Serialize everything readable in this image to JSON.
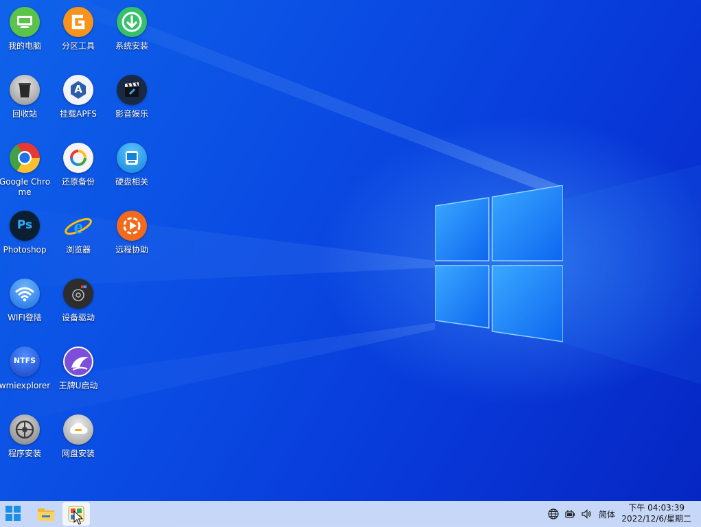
{
  "desktop": {
    "icons": [
      {
        "label": "我的电脑",
        "icon": "monitor-icon"
      },
      {
        "label": "分区工具",
        "icon": "partition-tool-icon"
      },
      {
        "label": "系统安装",
        "icon": "download-install-icon"
      },
      {
        "label": "回收站",
        "icon": "recycle-bin-icon"
      },
      {
        "label": "挂载APFS",
        "icon": "apfs-icon"
      },
      {
        "label": "影音娱乐",
        "icon": "clapper-icon"
      },
      {
        "label": "Google Chrome",
        "icon": "chrome-icon"
      },
      {
        "label": "还原备份",
        "icon": "restore-icon"
      },
      {
        "label": "硬盘相关",
        "icon": "disk-icon"
      },
      {
        "label": "Photoshop",
        "icon": "photoshop-icon"
      },
      {
        "label": "浏览器",
        "icon": "ie-icon"
      },
      {
        "label": "远程协助",
        "icon": "remote-icon"
      },
      {
        "label": "WIFI登陆",
        "icon": "wifi-icon"
      },
      {
        "label": "设备驱动",
        "icon": "driver-icon"
      },
      {
        "label": "wmiexplorer",
        "icon": "ntfs-icon",
        "text": "NTFS"
      },
      {
        "label": "王牌U启动",
        "icon": "u-boot-icon"
      },
      {
        "label": "程序安装",
        "icon": "settings-icon"
      },
      {
        "label": "网盘安装",
        "icon": "cloud-disk-icon"
      }
    ],
    "photoshop_text": "Ps",
    "apfs_text": "A"
  },
  "taskbar": {
    "start_icon": "windows-start-icon",
    "explorer_icon": "folder-icon",
    "app_icon": "pe-tool-icon",
    "tray": {
      "network_icon": "globe-icon",
      "battery_icon": "power-icon",
      "volume_icon": "speaker-icon",
      "ime_label": "简体"
    },
    "clock": {
      "time": "下午 04:03:39",
      "date": "2022/12/6/星期二"
    }
  },
  "colors": {
    "desktop_blue": "#0a45e0",
    "taskbar_bg": "#d7e4fa"
  }
}
